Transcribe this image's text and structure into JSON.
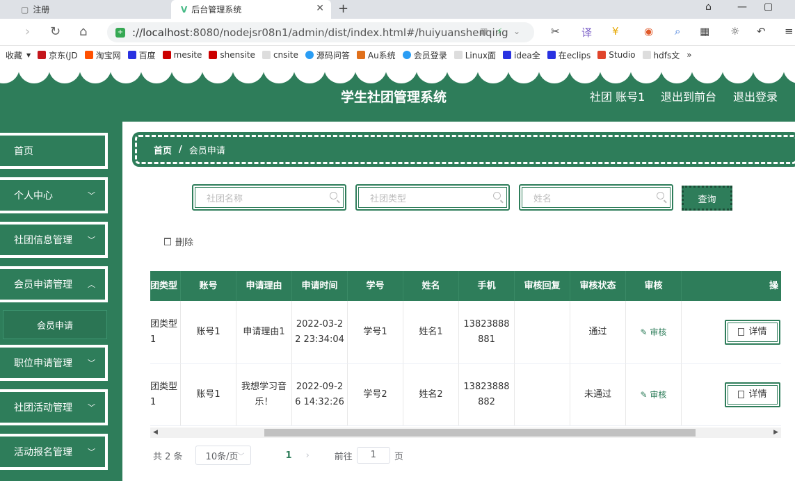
{
  "browser": {
    "tabs": [
      {
        "label": "注册"
      },
      {
        "label": "后台管理系统"
      }
    ],
    "url_host": "://localhost",
    "url_rest": ":8080/nodejsr08n1/admin/dist/index.html#/huiyuanshenqing",
    "bookmarks": [
      "收藏",
      "京东(JD",
      "淘宝网",
      "百度",
      "mesite",
      "shensite",
      "cnsite",
      "源码问答",
      "Au系统",
      "会员登录",
      "Linux面",
      "idea全",
      "在eclips",
      "Studio",
      "hdfs文"
    ]
  },
  "header": {
    "title": "学生社团管理系统",
    "user_label": "社团 账号1",
    "to_front": "退出到前台",
    "logout": "退出登录"
  },
  "sidebar": {
    "items": [
      {
        "label": "首页"
      },
      {
        "label": "个人中心"
      },
      {
        "label": "社团信息管理"
      },
      {
        "label": "会员申请管理"
      },
      {
        "label": "职位申请管理"
      },
      {
        "label": "社团活动管理"
      },
      {
        "label": "活动报名管理"
      }
    ],
    "sub_active": "会员申请"
  },
  "breadcrumb": {
    "home": "首页",
    "sep": "/",
    "current": "会员申请"
  },
  "search": {
    "club_name_placeholder": "社团名称",
    "club_type_placeholder": "社团类型",
    "name_placeholder": "姓名",
    "query_label": "查询"
  },
  "actions": {
    "delete_label": "删除"
  },
  "table": {
    "headers": [
      "团类型",
      "账号",
      "申请理由",
      "申请时间",
      "学号",
      "姓名",
      "手机",
      "审核回复",
      "审核状态",
      "审核",
      "操"
    ],
    "rows": [
      {
        "type": "团类型1",
        "account": "账号1",
        "reason": "申请理由1",
        "time": "2022-03-22 23:34:04",
        "sno": "学号1",
        "name": "姓名1",
        "phone": "13823888881",
        "reply": "",
        "status": "通过",
        "audit": "审核",
        "detail": "详情"
      },
      {
        "type": "团类型1",
        "account": "账号1",
        "reason": "我想学习音乐！",
        "time": "2022-09-26 14:32:26",
        "sno": "学号2",
        "name": "姓名2",
        "phone": "13823888882",
        "reply": "",
        "status": "未通过",
        "audit": "审核",
        "detail": "详情"
      }
    ]
  },
  "pagination": {
    "total": "共 2 条",
    "page_size": "10条/页",
    "current_page": "1",
    "goto_label": "前往",
    "goto_value": "1",
    "page_unit": "页"
  },
  "colors": {
    "primary": "#2e7d5a"
  }
}
